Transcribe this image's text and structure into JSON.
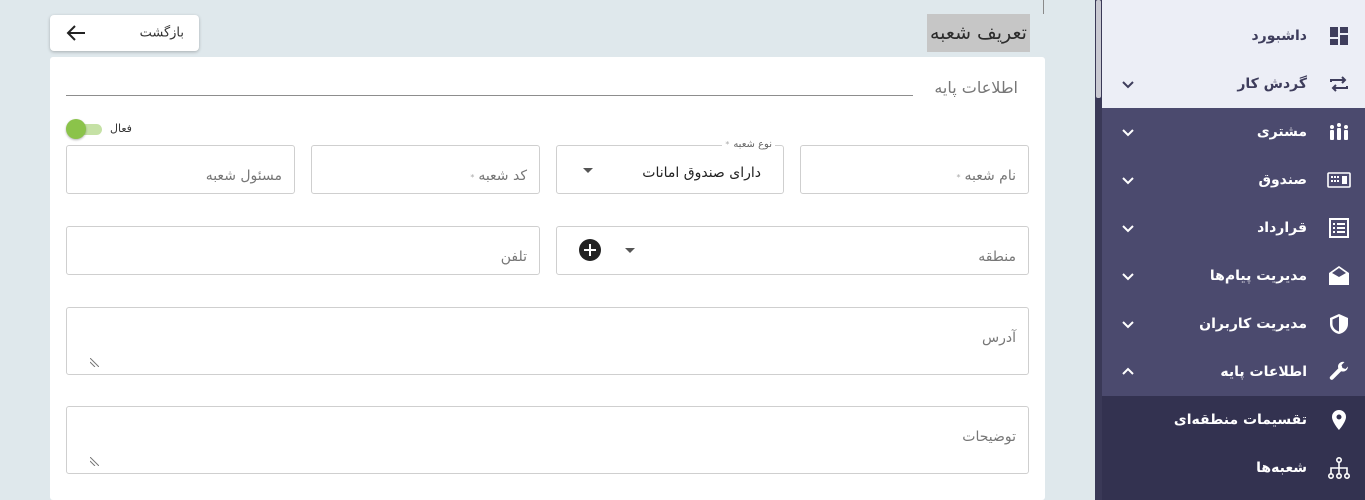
{
  "header": {
    "title": "تعریف شعبه",
    "back_label": "بازگشت"
  },
  "sidebar": {
    "items": [
      {
        "label": "داشبورد",
        "icon": "dashboard-icon"
      },
      {
        "label": "گردش کار",
        "icon": "repeat-icon"
      },
      {
        "label": "مشتری",
        "icon": "people-icon"
      },
      {
        "label": "صندوق",
        "icon": "safe-icon"
      },
      {
        "label": "قرارداد",
        "icon": "contract-icon"
      },
      {
        "label": "مدیریت پیام‌ها",
        "icon": "envelope-icon"
      },
      {
        "label": "مدیریت کاربران",
        "icon": "shield-icon"
      },
      {
        "label": "اطلاعات پایه",
        "icon": "wrench-icon"
      }
    ],
    "subitems": [
      {
        "label": "تقسیمات منطقه‌ای",
        "icon": "location-pin-icon"
      },
      {
        "label": "شعبه‌ها",
        "icon": "hierarchy-icon"
      }
    ]
  },
  "form": {
    "section_title": "اطلاعات پایه",
    "active_toggle_label": "فعال",
    "branch_name_placeholder": "نام شعبه",
    "branch_type_label": "نوع شعبه",
    "branch_type_value": "دارای صندوق امانات",
    "branch_code_placeholder": "کد شعبه",
    "branch_manager_placeholder": "مسئول شعبه",
    "region_placeholder": "منطقه",
    "phone_placeholder": "تلفن",
    "address_placeholder": "آدرس",
    "description_placeholder": "توضیحات",
    "required_mark": "*"
  },
  "colors": {
    "sidebar_bg": "#4b4a6e",
    "sidebar_sub_bg": "#333250",
    "sidebar_top_bg": "#eceef6",
    "toggle_on": "#8bc34a",
    "page_bg": "#dfe8ec"
  }
}
